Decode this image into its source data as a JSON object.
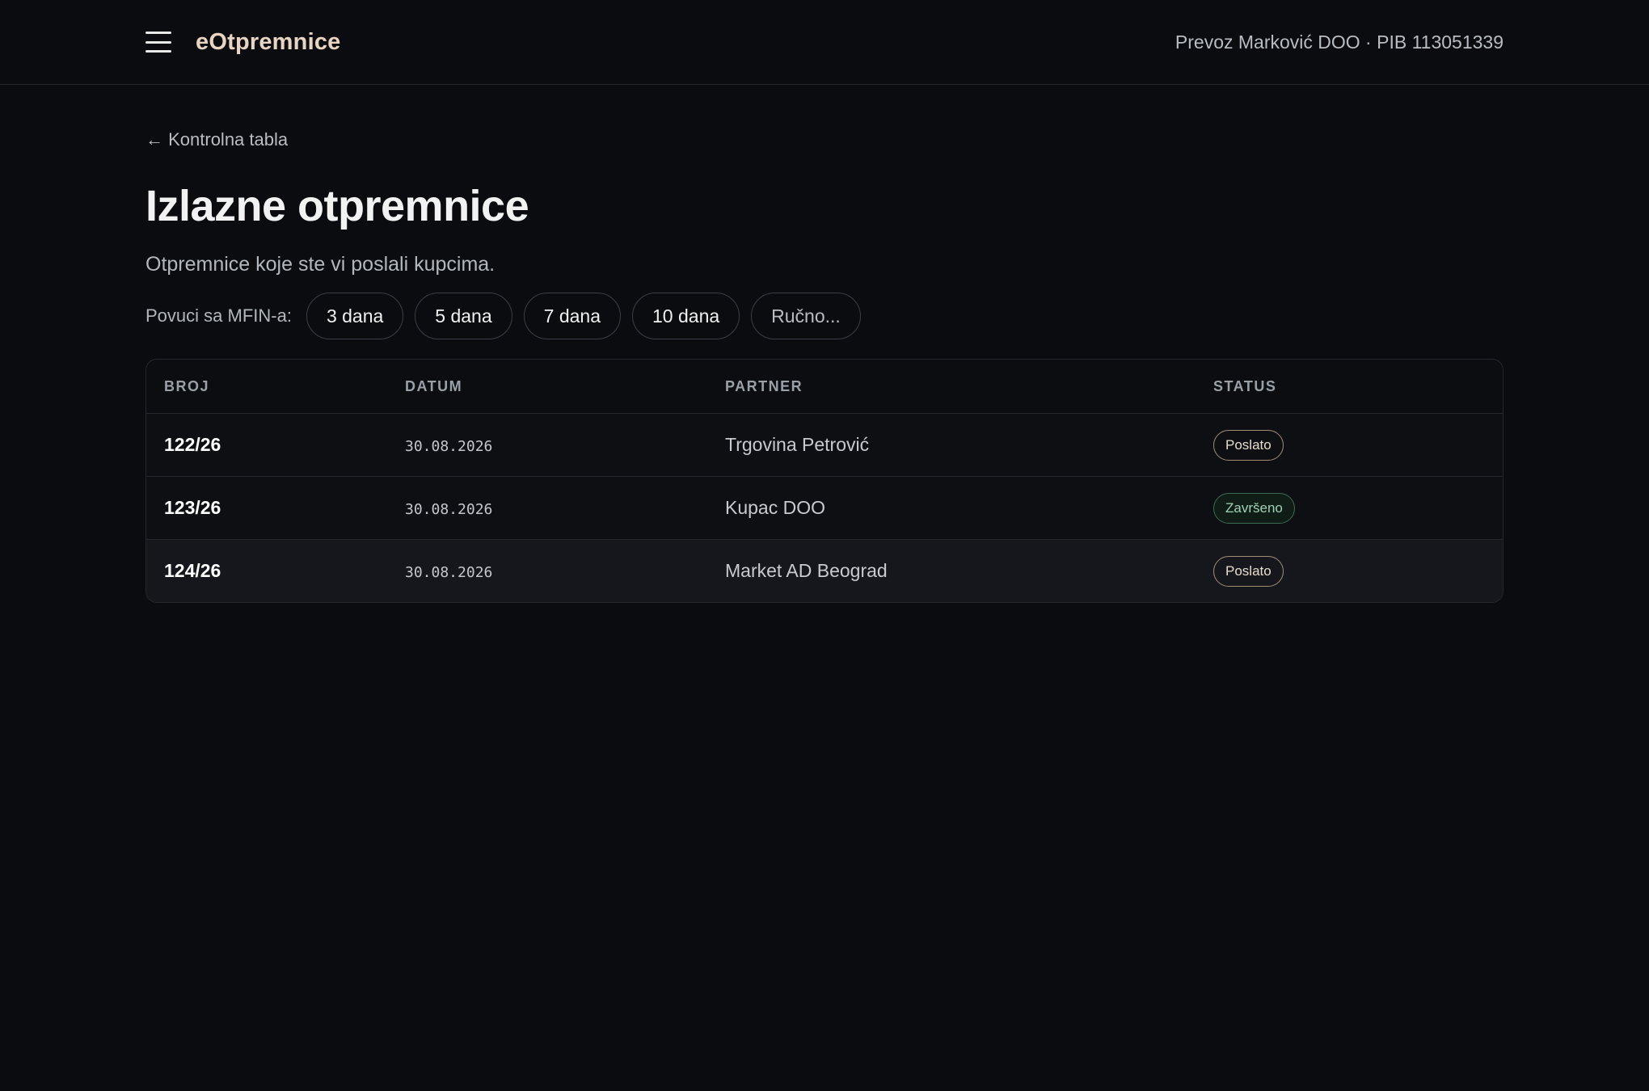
{
  "header": {
    "menu_icon": "hamburger-menu-icon",
    "app_title": "eOtpremnice",
    "org_info": "Prevoz Marković DOO · PIB 113051339"
  },
  "main": {
    "back_link": "← Kontrolna tabla",
    "title": "Izlazne otpremnice",
    "subtitle": "Otpremnice koje ste vi poslali kupcima.",
    "filter": {
      "label": "Povuci sa MFIN-a:",
      "chips": [
        "3 dana",
        "5 dana",
        "7 dana",
        "10 dana",
        "Ručno..."
      ]
    },
    "table": {
      "columns": [
        "BROJ",
        "DATUM",
        "PARTNER",
        "STATUS"
      ],
      "rows": [
        {
          "broj": "122/26",
          "datum": "30.08.2026",
          "partner": "Trgovina Petrović",
          "status": "Poslato"
        },
        {
          "broj": "123/26",
          "datum": "30.08.2026",
          "partner": "Kupac DOO",
          "status": "Završeno"
        },
        {
          "broj": "124/26",
          "datum": "30.08.2026",
          "partner": "Market AD Beograd",
          "status": "Poslato"
        }
      ]
    }
  },
  "colors": {
    "background": "#0b0c0f",
    "brand": "#e8d4c2",
    "status_sent_border": "#a08e78",
    "status_done": "#9ed2b3"
  }
}
